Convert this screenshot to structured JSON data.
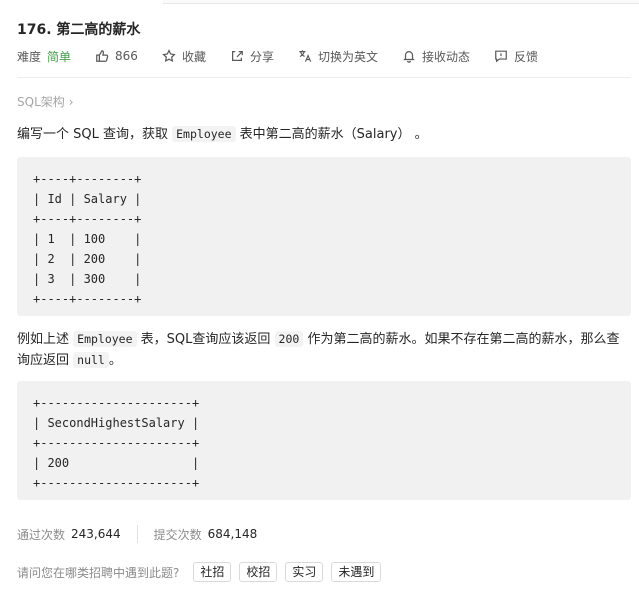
{
  "problem": {
    "title": "176. 第二高的薪水",
    "difficulty_label": "难度",
    "difficulty_value": "简单",
    "likes": "866",
    "favorite_label": "收藏",
    "share_label": "分享",
    "translate_label": "切换为英文",
    "follow_label": "接收动态",
    "feedback_label": "反馈",
    "tag": "SQL架构",
    "tag_chevron": "›"
  },
  "content": {
    "p1": {
      "before": "编写一个 SQL 查询，获取 ",
      "code": "Employee",
      "after": " 表中第二高的薪水（Salary） 。"
    },
    "table1": "+----+--------+\n| Id | Salary |\n+----+--------+\n| 1  | 100    |\n| 2  | 200    |\n| 3  | 300    |\n+----+--------+",
    "p2": {
      "a": "例如上述 ",
      "code1": "Employee",
      "b": " 表，SQL查询应该返回 ",
      "code2": "200",
      "c": " 作为第二高的薪水。如果不存在第二高的薪水，那么查询应返回 ",
      "code3": "null",
      "d": "。"
    },
    "table2": "+---------------------+\n| SecondHighestSalary |\n+---------------------+\n| 200                 |\n+---------------------+"
  },
  "stats": {
    "passed_label": "通过次数",
    "passed_value": "243,644",
    "submitted_label": "提交次数",
    "submitted_value": "684,148"
  },
  "interview": {
    "question": "请问您在哪类招聘中遇到此题?",
    "options": [
      "社招",
      "校招",
      "实习",
      "未遇到"
    ]
  },
  "colors": {
    "easy": "#43a047",
    "muted": "#8c8c8c",
    "code_bg": "#f1f1f1"
  }
}
